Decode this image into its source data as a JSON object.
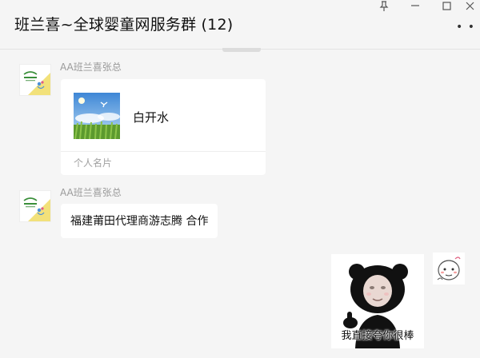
{
  "header": {
    "title": "班兰喜~全球婴童网服务群 (12)",
    "pin_icon": "pin-icon",
    "minimize_icon": "minimize-icon",
    "maximize_icon": "maximize-icon",
    "close_icon": "close-icon",
    "more_icon": "more-icon"
  },
  "messages": [
    {
      "sender": "AA班兰喜张总",
      "type": "contact-card",
      "card": {
        "name": "白开水",
        "footer": "个人名片"
      }
    },
    {
      "sender": "AA班兰喜张总",
      "type": "text",
      "text": "福建莆田代理商游志腾   合作"
    },
    {
      "sender": "self",
      "type": "sticker",
      "caption": "我直接夸你很棒"
    }
  ],
  "colors": {
    "background": "#f5f5f5",
    "bubble": "#ffffff",
    "sender_name": "#9a9a9a"
  }
}
